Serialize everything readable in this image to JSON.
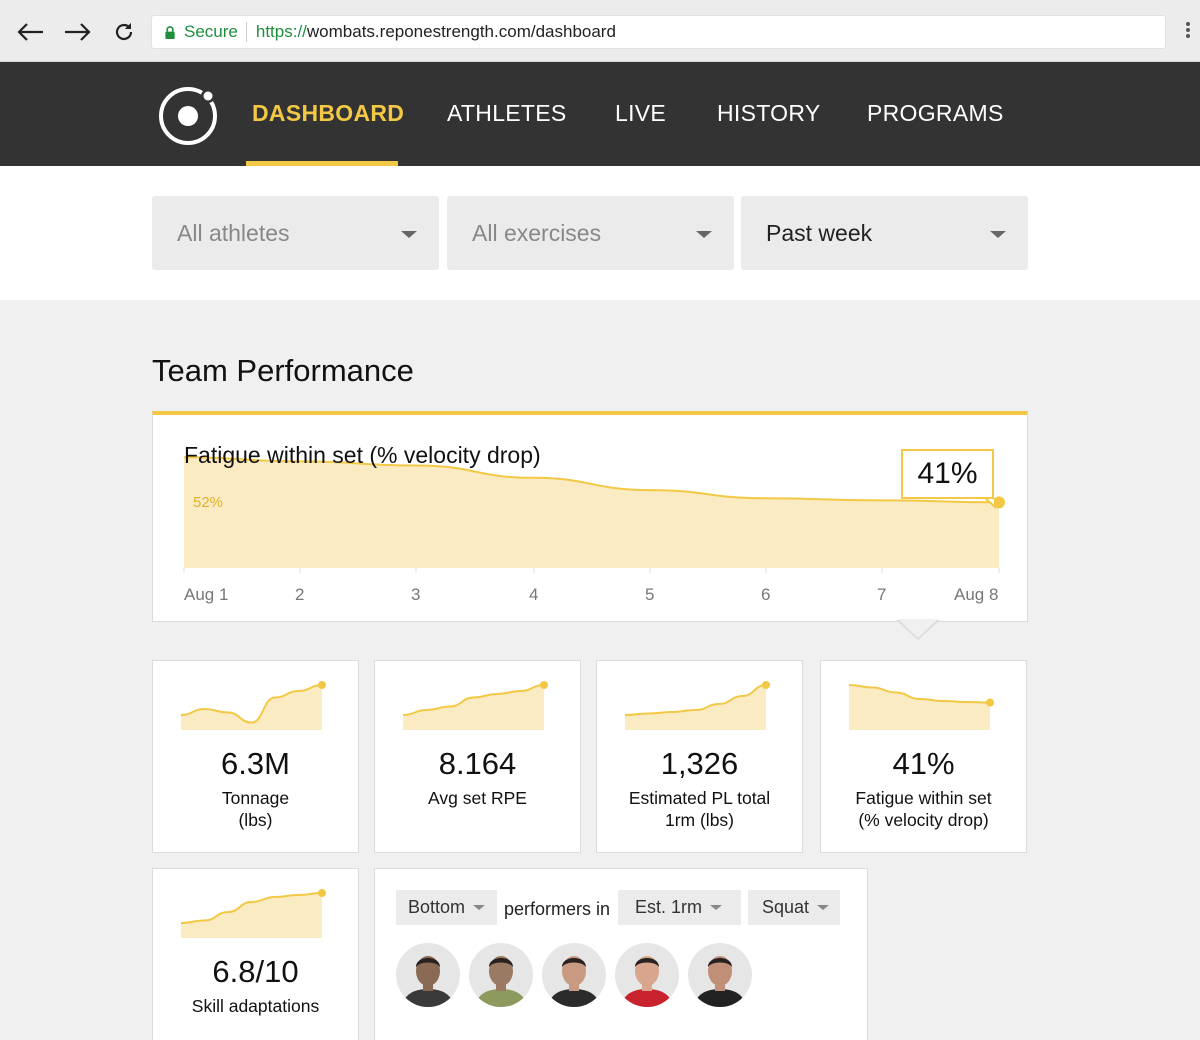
{
  "browser": {
    "secure_label": "Secure",
    "url_scheme": "https://",
    "url_rest": "wombats.reponestrength.com/dashboard"
  },
  "nav": {
    "items": [
      "DASHBOARD",
      "ATHLETES",
      "LIVE",
      "HISTORY",
      "PROGRAMS"
    ],
    "active": "DASHBOARD",
    "accent_color": "#f3c844"
  },
  "filters": {
    "athletes": "All athletes",
    "exercises": "All exercises",
    "period": "Past week"
  },
  "section_title": "Team Performance",
  "fatigue_card": {
    "title": "Fatigue within set (% velocity drop)",
    "start_label": "52%",
    "current_label": "41%",
    "x_ticks": [
      "Aug 1",
      "2",
      "3",
      "4",
      "5",
      "6",
      "7",
      "Aug 8"
    ]
  },
  "chart_data": {
    "type": "area",
    "title": "Fatigue within set (% velocity drop)",
    "x": [
      "Aug 1",
      "2",
      "3",
      "4",
      "5",
      "6",
      "7",
      "Aug 8"
    ],
    "series": [
      {
        "values": [
          52,
          51,
          50,
          47,
          44,
          42,
          41.5,
          41
        ]
      }
    ],
    "ylim": [
      25,
      55
    ],
    "annotations": [
      "52%",
      "41%"
    ],
    "grid": false
  },
  "stats": [
    {
      "value": "6.3M",
      "label_line1": "Tonnage",
      "label_line2": "(lbs)",
      "trend": [
        0.3,
        0.42,
        0.35,
        0.15,
        0.65,
        0.78,
        0.9
      ]
    },
    {
      "value": "8.164",
      "label_line1": "Avg set RPE",
      "label_line2": "",
      "trend": [
        0.3,
        0.4,
        0.47,
        0.65,
        0.72,
        0.78,
        0.9
      ]
    },
    {
      "value": "1,326",
      "label_line1": "Estimated PL total",
      "label_line2": "1rm (lbs)",
      "trend": [
        0.3,
        0.33,
        0.36,
        0.4,
        0.52,
        0.68,
        0.9
      ]
    },
    {
      "value": "41%",
      "label_line1": "Fatigue within set",
      "label_line2": "(% velocity drop)",
      "trend": [
        0.9,
        0.85,
        0.75,
        0.62,
        0.58,
        0.56,
        0.55
      ]
    },
    {
      "value": "6.8/10",
      "label_line1": "Skill adaptations",
      "label_line2": "",
      "trend": [
        0.3,
        0.35,
        0.52,
        0.72,
        0.82,
        0.86,
        0.9
      ]
    }
  ],
  "performers": {
    "rank": "Bottom",
    "text": "performers in",
    "metric": "Est. 1rm",
    "exercise": "Squat",
    "avatars": [
      {
        "shirt": "#3a3a3a",
        "skin": "#8a6a55"
      },
      {
        "shirt": "#8c9a5e",
        "skin": "#9a7a63"
      },
      {
        "shirt": "#2b2b2b",
        "skin": "#c99a82"
      },
      {
        "shirt": "#c8232c",
        "skin": "#d8a68c"
      },
      {
        "shirt": "#222222",
        "skin": "#c08f78"
      }
    ]
  }
}
